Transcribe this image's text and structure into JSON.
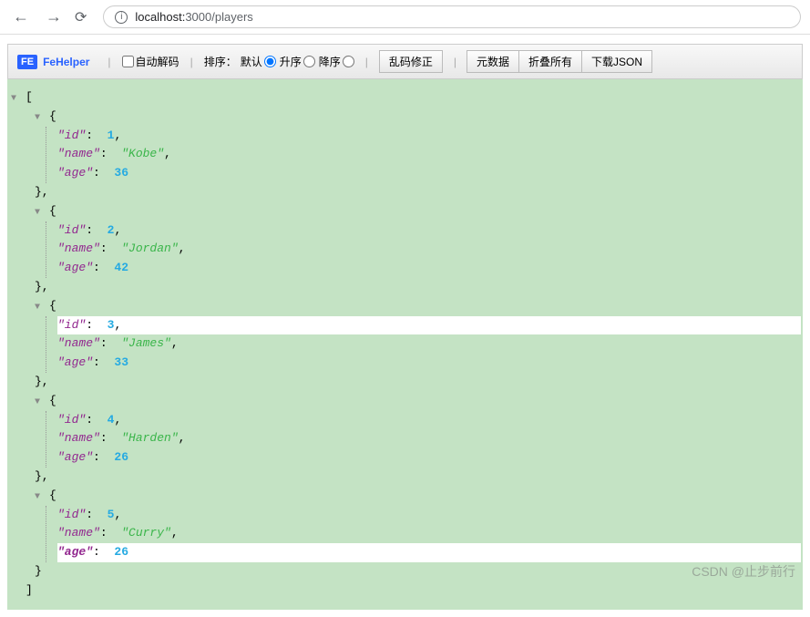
{
  "browser": {
    "url_host": "localhost:",
    "url_port_path": "3000/players"
  },
  "toolbar": {
    "logo_text": "FE",
    "title": "FeHelper",
    "auto_decode": "自动解码",
    "sort_label": "排序：",
    "sort_default": "默认",
    "sort_asc": "升序",
    "sort_desc": "降序",
    "btn_fix": "乱码修正",
    "btn_meta": "元数据",
    "btn_collapse": "折叠所有",
    "btn_download": "下载JSON"
  },
  "json": {
    "open_bracket": "[",
    "close_bracket": "]",
    "open_brace": "{",
    "close_brace": "}",
    "close_brace_comma": "},",
    "keys": {
      "id": "\"id\"",
      "name": "\"name\"",
      "age": "\"age\""
    },
    "records": [
      {
        "id": "1",
        "name": "\"Kobe\"",
        "age": "36"
      },
      {
        "id": "2",
        "name": "\"Jordan\"",
        "age": "42"
      },
      {
        "id": "3",
        "name": "\"James\"",
        "age": "33"
      },
      {
        "id": "4",
        "name": "\"Harden\"",
        "age": "26"
      },
      {
        "id": "5",
        "name": "\"Curry\"",
        "age": "26"
      }
    ]
  },
  "watermark": "CSDN @止步前行"
}
